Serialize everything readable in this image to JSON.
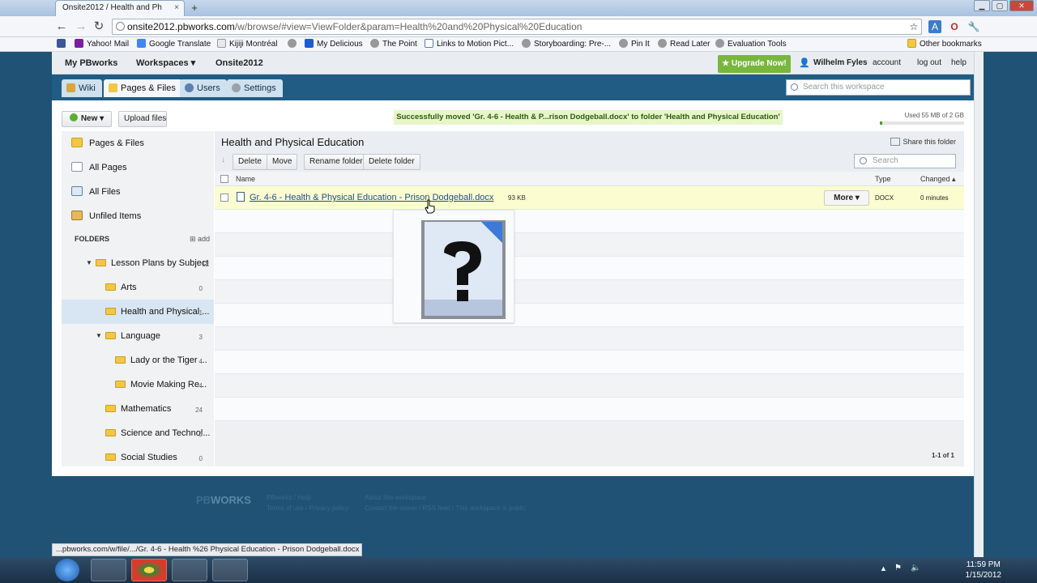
{
  "browser": {
    "tab_title": "Onsite2012 / Health and Ph",
    "tab_close": "×",
    "new_tab": "+",
    "url_host": "onsite2012.pbworks.com",
    "url_path": "/w/browse/#view=ViewFolder&param=Health%20and%20Physical%20Education",
    "status_url": "...pbworks.com/w/file/.../Gr. 4-6 - Health %26 Physical Education - Prison Dodgeball.docx"
  },
  "bookmarks": [
    "Yahoo! Mail",
    "Google Translate",
    "Kijiji Montréal",
    "My Delicious",
    "The Point",
    "Links to Motion Pict...",
    "Storyboarding: Pre-...",
    "Pin It",
    "Read Later",
    "Evaluation Tools"
  ],
  "bookmarks_other": "Other bookmarks",
  "topbar": {
    "my_pbworks": "My PBworks",
    "workspaces": "Workspaces ▾",
    "workspace_name": "Onsite2012",
    "upgrade": "★ Upgrade Now!",
    "user": "Wilhelm Fyles",
    "account": "account",
    "logout": "log out",
    "help": "help"
  },
  "navtabs": [
    "Wiki",
    "Pages & Files",
    "Users",
    "Settings"
  ],
  "workspace_search_placeholder": "Search this workspace",
  "actions": {
    "new": "New ▾",
    "upload": "Upload files",
    "flash": "Successfully moved 'Gr. 4-6 - Health & P...rison Dodgeball.docx' to folder 'Health and Physical Education'",
    "usage": "Used 55 MB of 2 GB",
    "usage_fraction": 0.03
  },
  "sidebar": {
    "items": [
      "Pages & Files",
      "All Pages",
      "All Files",
      "Unfiled Items"
    ],
    "folders_label": "FOLDERS",
    "add_label": "add",
    "folders": [
      {
        "name": "Lesson Plans by Subject",
        "count": "12"
      },
      {
        "name": "Arts",
        "count": "0"
      },
      {
        "name": "Health and Physical ...",
        "count": "1"
      },
      {
        "name": "Language",
        "count": "3"
      },
      {
        "name": "Lady or the Tiger ...",
        "count": "4"
      },
      {
        "name": "Movie Making Re...",
        "count": "4"
      },
      {
        "name": "Mathematics",
        "count": "24"
      },
      {
        "name": "Science and Technol...",
        "count": "0"
      },
      {
        "name": "Social Studies",
        "count": "0"
      }
    ]
  },
  "main": {
    "title": "Health and Physical Education",
    "share": "Share this folder",
    "toolbar": [
      "Delete",
      "Move",
      "Rename folder",
      "Delete folder"
    ],
    "search_placeholder": "Search",
    "columns": {
      "name": "Name",
      "type": "Type",
      "changed": "Changed ▴"
    },
    "file": {
      "name": "Gr. 4-6 - Health & Physical Education - Prison Dodgeball.docx",
      "size": "93 KB",
      "more": "More ▾",
      "type": "DOCX",
      "changed": "0 minutes"
    },
    "paging": "1-1 of 1"
  },
  "footer": {
    "brand_pb": "PB",
    "brand_works": "WORKS",
    "links1": "PBworks / Help",
    "links2": "Terms of use / Privacy policy",
    "about": "About this workspace",
    "about_links": "Contact the owner / RSS feed / This workspace is public"
  },
  "clock": {
    "time": "11:59 PM",
    "date": "1/15/2012"
  }
}
